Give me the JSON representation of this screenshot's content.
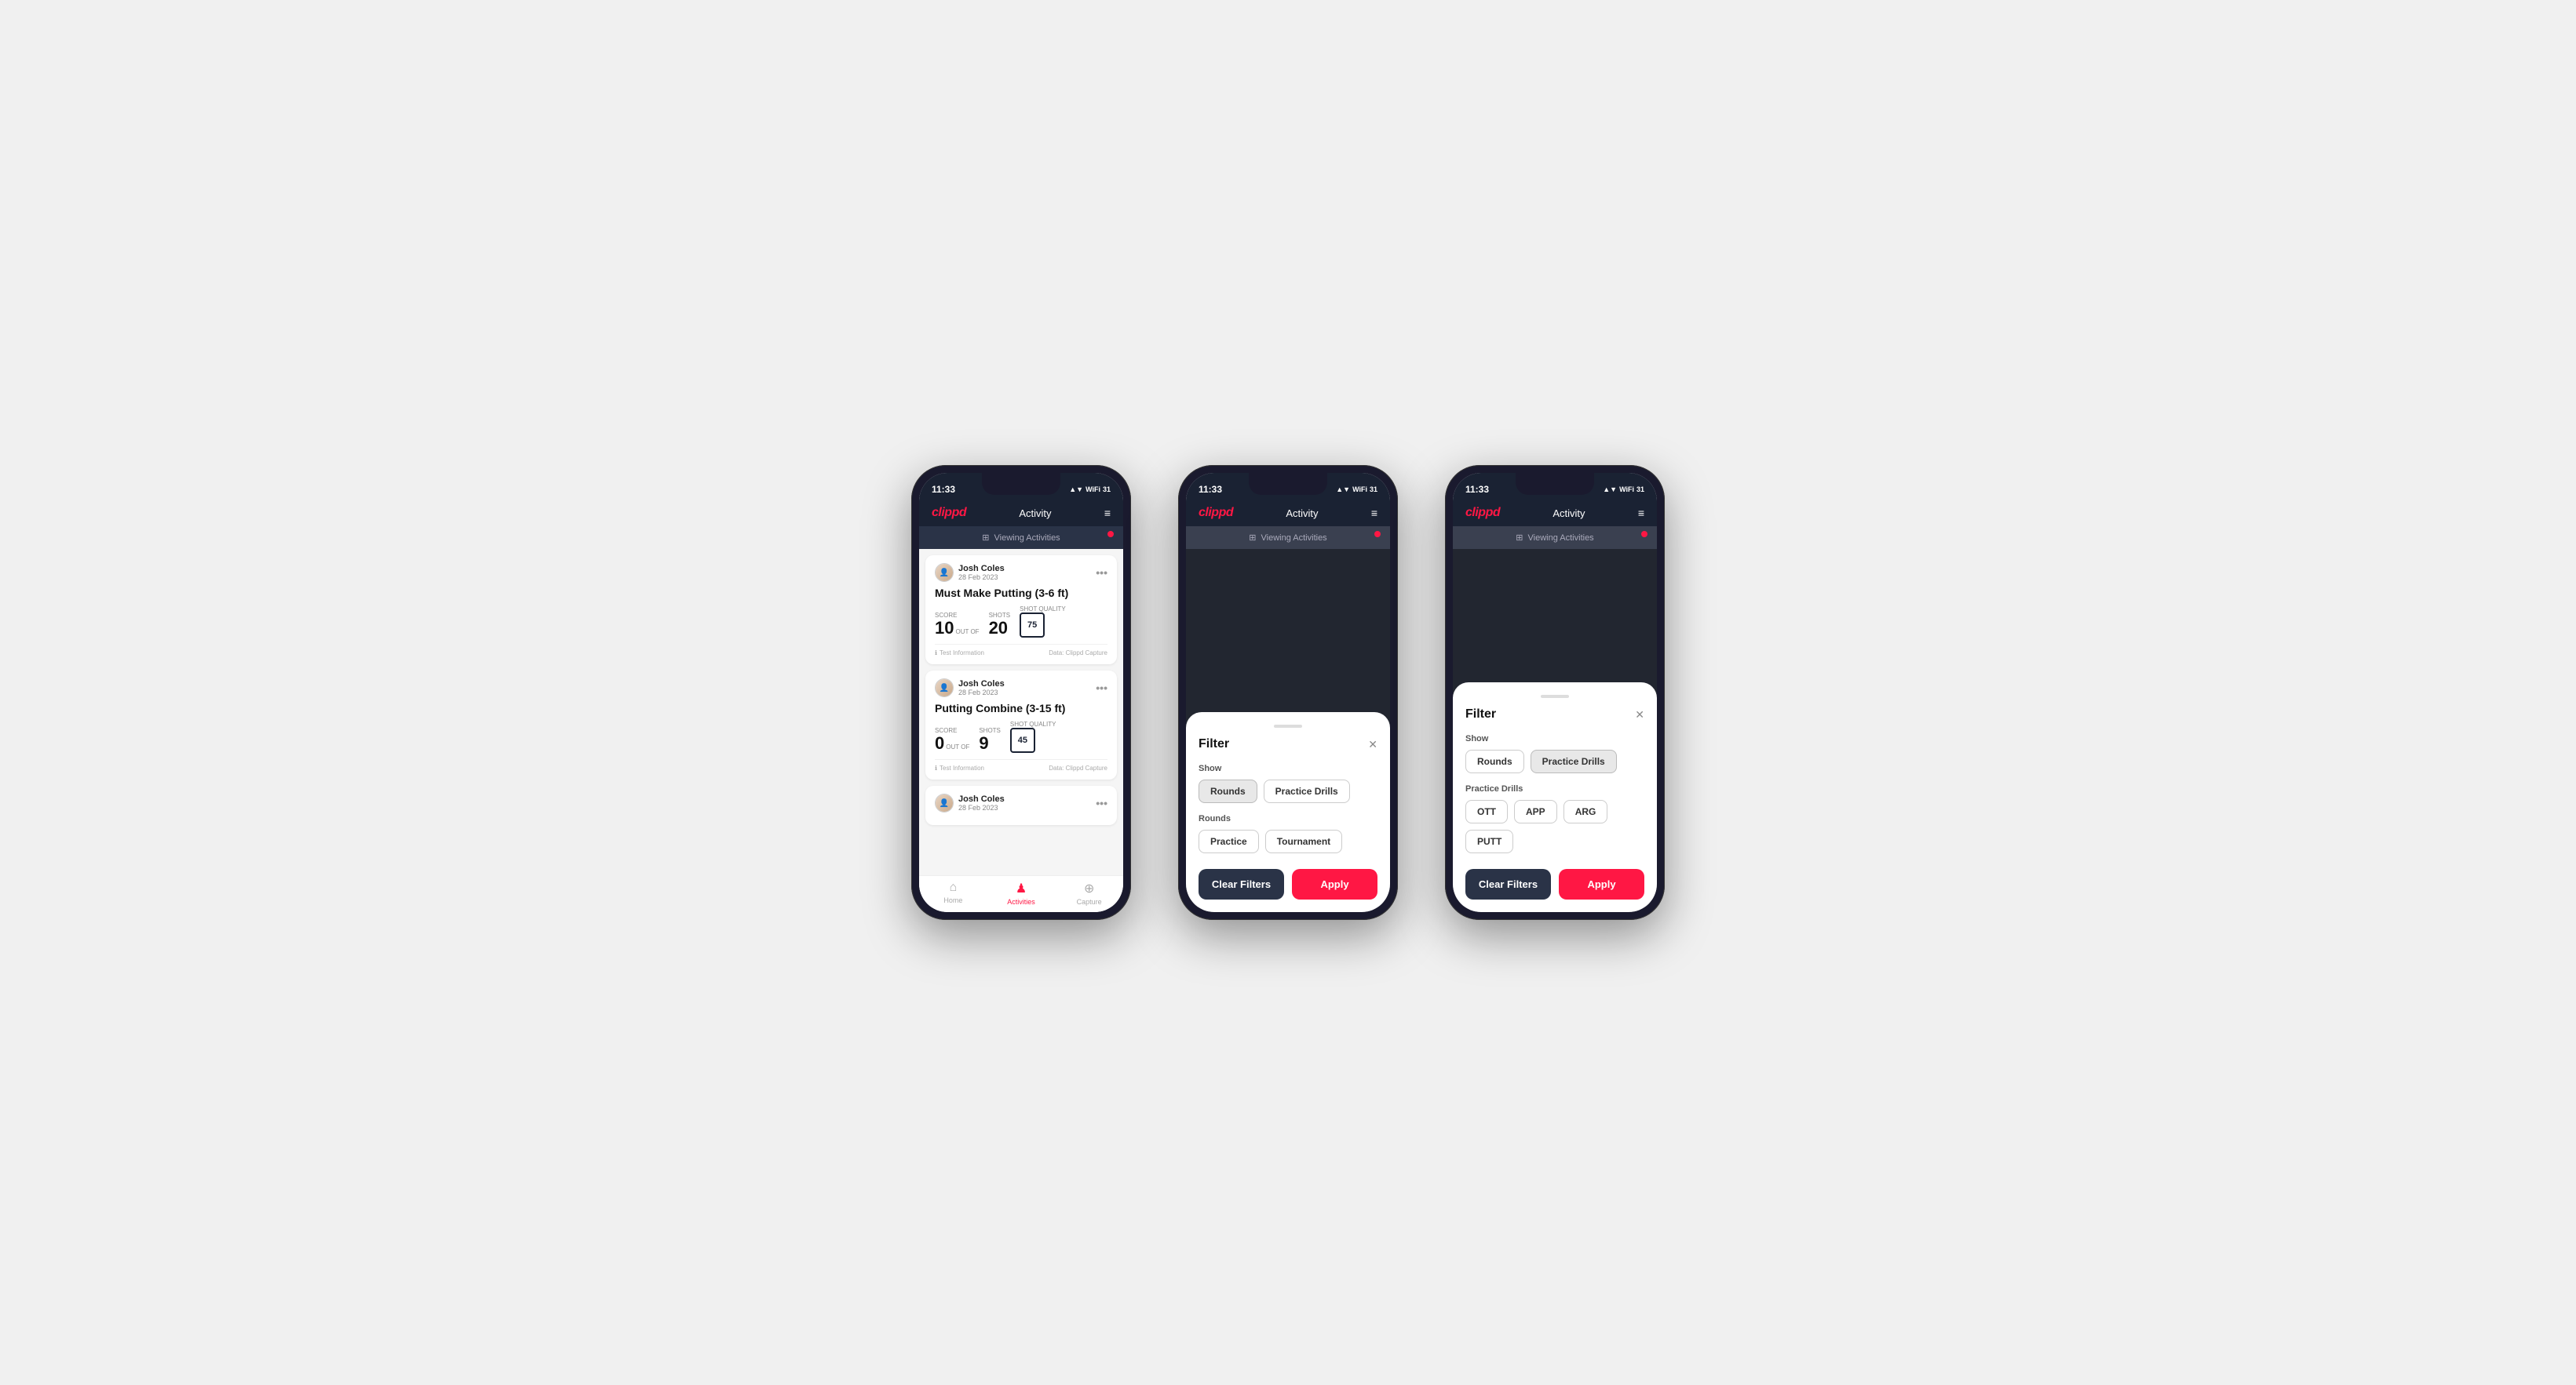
{
  "phones": [
    {
      "id": "phone1",
      "statusBar": {
        "time": "11:33",
        "icons": "▲ ▼ WiFi 31"
      },
      "header": {
        "logo": "clippd",
        "title": "Activity",
        "menuIcon": "≡"
      },
      "viewingBar": {
        "text": "Viewing Activities",
        "icon": "⊞"
      },
      "activities": [
        {
          "userName": "Josh Coles",
          "userDate": "28 Feb 2023",
          "title": "Must Make Putting (3-6 ft)",
          "scoreLbl": "Score",
          "scoreVal": "10",
          "outOf": "OUT OF",
          "shotsLbl": "Shots",
          "shotsVal": "20",
          "qualityLbl": "Shot Quality",
          "qualityVal": "75",
          "infoText": "Test Information",
          "sourceText": "Data: Clippd Capture"
        },
        {
          "userName": "Josh Coles",
          "userDate": "28 Feb 2023",
          "title": "Putting Combine (3-15 ft)",
          "scoreLbl": "Score",
          "scoreVal": "0",
          "outOf": "OUT OF",
          "shotsLbl": "Shots",
          "shotsVal": "9",
          "qualityLbl": "Shot Quality",
          "qualityVal": "45",
          "infoText": "Test Information",
          "sourceText": "Data: Clippd Capture"
        },
        {
          "userName": "Josh Coles",
          "userDate": "28 Feb 2023",
          "title": "",
          "scoreLbl": "",
          "scoreVal": "",
          "outOf": "",
          "shotsLbl": "",
          "shotsVal": "",
          "qualityLbl": "",
          "qualityVal": "",
          "infoText": "",
          "sourceText": ""
        }
      ],
      "bottomNav": {
        "items": [
          {
            "icon": "⌂",
            "label": "Home",
            "active": false
          },
          {
            "icon": "♟",
            "label": "Activities",
            "active": true
          },
          {
            "icon": "⊕",
            "label": "Capture",
            "active": false
          }
        ]
      },
      "showFilter": false
    },
    {
      "id": "phone2",
      "statusBar": {
        "time": "11:33",
        "icons": "▲ ▼ WiFi 31"
      },
      "header": {
        "logo": "clippd",
        "title": "Activity",
        "menuIcon": "≡"
      },
      "viewingBar": {
        "text": "Viewing Activities",
        "icon": "⊞"
      },
      "showFilter": true,
      "filter": {
        "title": "Filter",
        "showLabel": "Show",
        "showButtons": [
          {
            "label": "Rounds",
            "active": true
          },
          {
            "label": "Practice Drills",
            "active": false
          }
        ],
        "roundsLabel": "Rounds",
        "roundsButtons": [
          {
            "label": "Practice",
            "active": false
          },
          {
            "label": "Tournament",
            "active": false
          }
        ],
        "practiceSection": false,
        "practiceLabel": "",
        "practiceButtons": [],
        "clearLabel": "Clear Filters",
        "applyLabel": "Apply"
      }
    },
    {
      "id": "phone3",
      "statusBar": {
        "time": "11:33",
        "icons": "▲ ▼ WiFi 31"
      },
      "header": {
        "logo": "clippd",
        "title": "Activity",
        "menuIcon": "≡"
      },
      "viewingBar": {
        "text": "Viewing Activities",
        "icon": "⊞"
      },
      "showFilter": true,
      "filter": {
        "title": "Filter",
        "showLabel": "Show",
        "showButtons": [
          {
            "label": "Rounds",
            "active": false
          },
          {
            "label": "Practice Drills",
            "active": true
          }
        ],
        "roundsLabel": "",
        "roundsButtons": [],
        "practiceSection": true,
        "practiceLabel": "Practice Drills",
        "practiceButtons": [
          {
            "label": "OTT",
            "active": false
          },
          {
            "label": "APP",
            "active": false
          },
          {
            "label": "ARG",
            "active": false
          },
          {
            "label": "PUTT",
            "active": false
          }
        ],
        "clearLabel": "Clear Filters",
        "applyLabel": "Apply"
      }
    }
  ],
  "colors": {
    "accent": "#ff1744",
    "dark": "#1a2233",
    "darkAlt": "#2a3347"
  }
}
